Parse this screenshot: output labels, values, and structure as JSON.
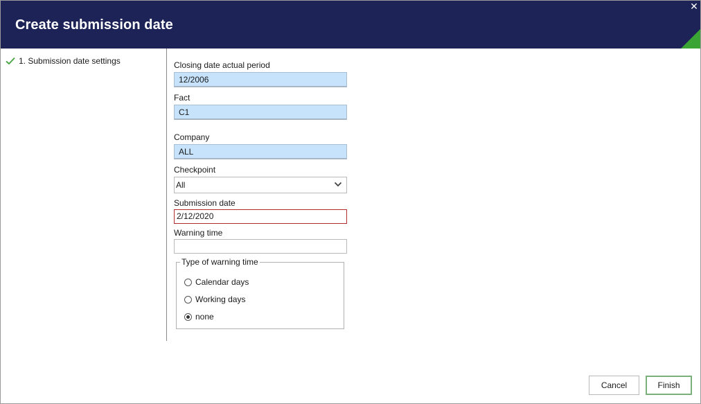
{
  "dialog": {
    "title": "Create submission date",
    "close_glyph": "✕",
    "accent_color": "#3aa535",
    "header_color": "#1d2356"
  },
  "sidebar": {
    "steps": [
      {
        "label": "1. Submission date settings",
        "icon": "check-icon",
        "completed": true
      }
    ]
  },
  "form": {
    "closing_date": {
      "label": "Closing date actual period",
      "value": "12/2006"
    },
    "fact": {
      "label": "Fact",
      "value": "C1"
    },
    "company": {
      "label": "Company",
      "value": "ALL"
    },
    "checkpoint": {
      "label": "Checkpoint",
      "value": "All"
    },
    "submission_date": {
      "label": "Submission date",
      "value": "2/12/2020"
    },
    "warning_time": {
      "label": "Warning time",
      "value": ""
    },
    "warning_type": {
      "legend": "Type of warning time",
      "options": [
        {
          "label": "Calendar days",
          "selected": false
        },
        {
          "label": "Working days",
          "selected": false
        },
        {
          "label": "none",
          "selected": true
        }
      ]
    }
  },
  "buttons": {
    "cancel": "Cancel",
    "finish": "Finish"
  }
}
